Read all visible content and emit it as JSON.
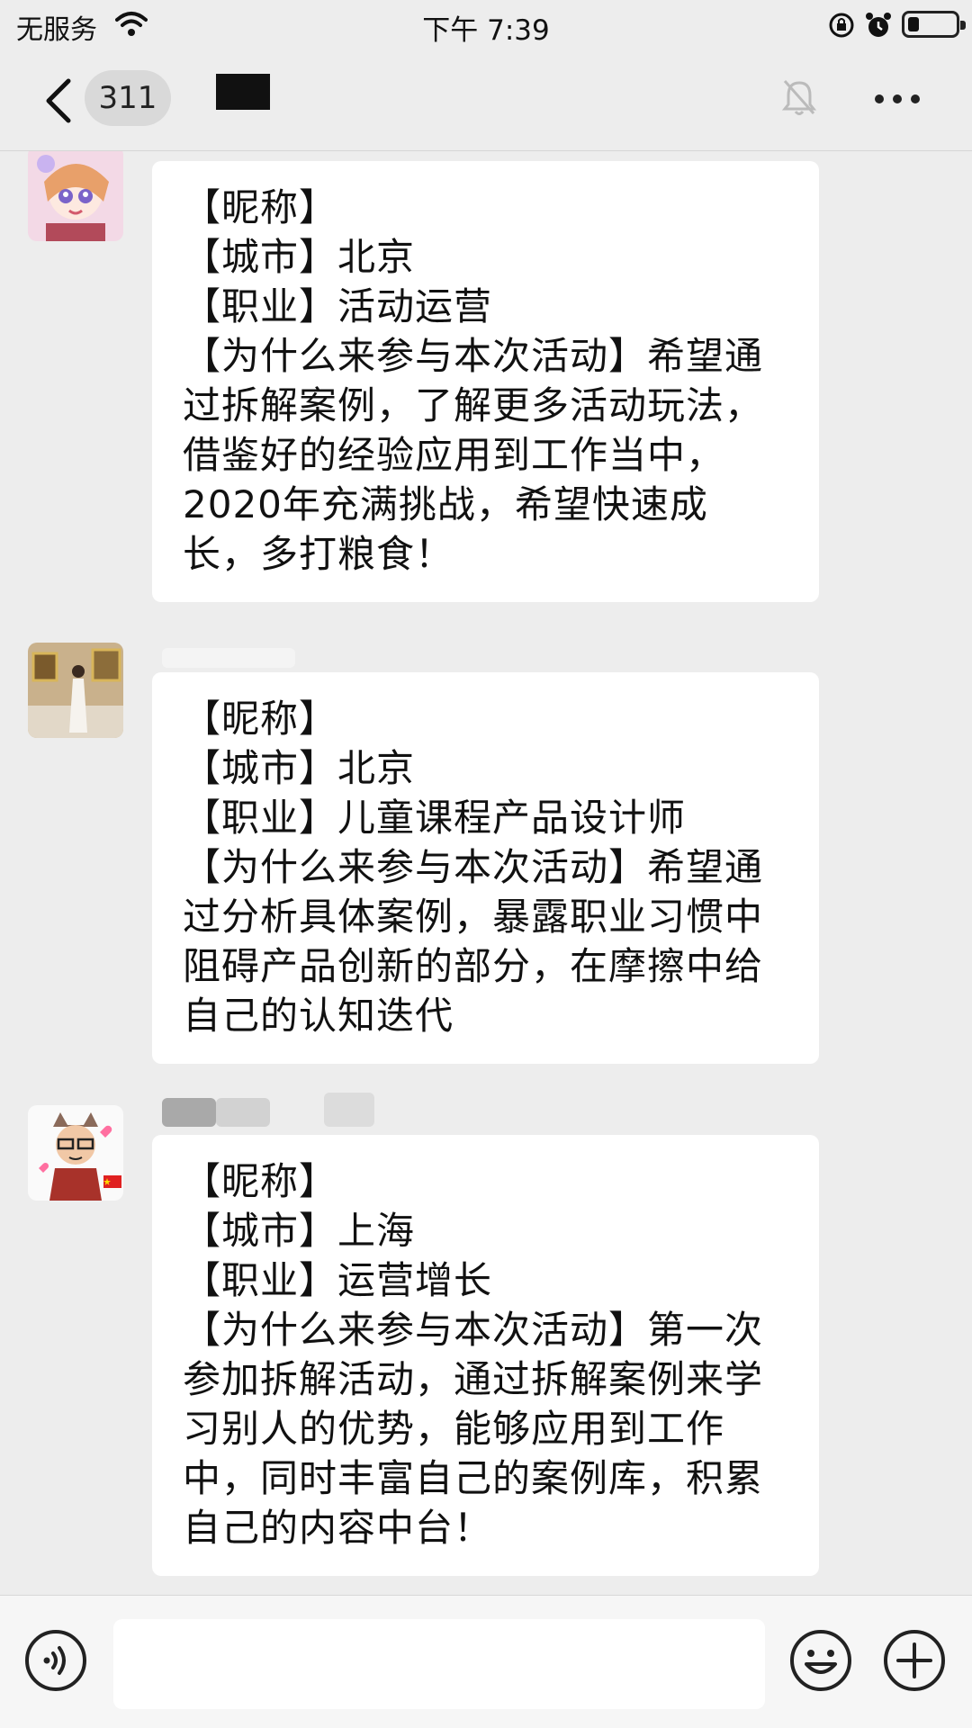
{
  "status_bar": {
    "carrier": "无服务",
    "time": "下午 7:39"
  },
  "nav": {
    "unread_count": "311"
  },
  "messages": [
    {
      "lines": [
        "【昵称】",
        "【城市】北京",
        "【职业】活动运营",
        "【为什么来参与本次活动】希望通",
        "过拆解案例，了解更多活动玩法，",
        "借鉴好的经验应用到工作当中，",
        "2020年充满挑战，希望快速成",
        "长，多打粮食！"
      ]
    },
    {
      "lines": [
        "【昵称】",
        "【城市】北京",
        "【职业】儿童课程产品设计师",
        "【为什么来参与本次活动】希望通",
        "过分析具体案例，暴露职业习惯中",
        "阻碍产品创新的部分，在摩擦中给",
        "自己的认知迭代"
      ]
    },
    {
      "lines": [
        "【昵称】",
        "【城市】上海",
        "【职业】运营增长",
        "【为什么来参与本次活动】第一次",
        "参加拆解活动，通过拆解案例来学",
        "习别人的优势，能够应用到工作",
        "中，同时丰富自己的案例库，积累",
        "自己的内容中台！"
      ]
    }
  ],
  "icons": {
    "back": "chevron-left-icon",
    "mute": "bell-slash-icon",
    "more": "more-icon",
    "voice": "voice-icon",
    "emoji": "emoji-icon",
    "add": "plus-icon"
  },
  "colors": {
    "background": "#ededed",
    "bubble": "#ffffff",
    "input_bar": "#f6f6f6"
  }
}
